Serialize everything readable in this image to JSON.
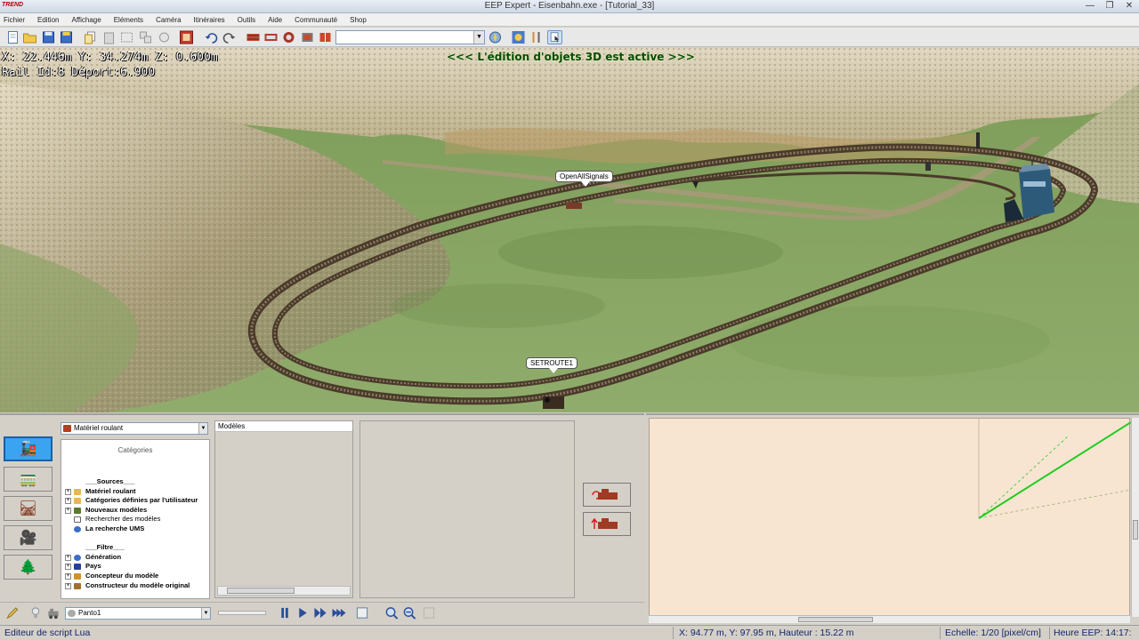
{
  "window": {
    "logo": "TREND",
    "title": "EEP Expert - Eisenbahn.exe - [Tutorial_33]",
    "controls": [
      "minimize",
      "restore",
      "close"
    ]
  },
  "menu": [
    "Fichier",
    "Edition",
    "Affichage",
    "Eléments",
    "Caméra",
    "Itinéraires",
    "Outils",
    "Aide",
    "Communauté",
    "Shop"
  ],
  "toolbar": {
    "search_value": "",
    "icons": [
      "new-file-icon",
      "open-folder-icon",
      "save-icon",
      "save-as-icon",
      "copy-icon",
      "paste-icon",
      "select-icon",
      "group-icon",
      "transfer-icon",
      "signal-editor-icon",
      "undo-icon",
      "redo-icon",
      "track-editor-icon",
      "track-system-icon",
      "tram-track-icon",
      "road-icon",
      "waterway-icon",
      "compass-icon",
      "tools-icon",
      "help-cursor-icon"
    ]
  },
  "viewport": {
    "coord_line": "X: 22.446m  Y: 34.274m  Z: 0.600m",
    "rail_line": "Rail Id:8 Déport:6.900",
    "banner": "<<<  L'édition d'objets 3D est active  >>>",
    "bubbles": {
      "open_signals": "OpenAllSignals",
      "set_route": "SETROUTE1"
    }
  },
  "library": {
    "dropdown": "Matériel roulant",
    "categories_title": "Catégories",
    "models_header": "Modèles",
    "tree": [
      {
        "label": "___Sources___",
        "bold": true,
        "expand": false,
        "icon": ""
      },
      {
        "label": "Matériel roulant",
        "bold": true,
        "expand": true,
        "icon": "folder"
      },
      {
        "label": "Catégories définies par l'utilisateur",
        "bold": true,
        "expand": true,
        "icon": "folder"
      },
      {
        "label": "Nouveaux modèles",
        "bold": true,
        "expand": true,
        "icon": "newmodel"
      },
      {
        "label": "Rechercher des modèles",
        "bold": false,
        "expand": false,
        "icon": "check"
      },
      {
        "label": "La recherche UMS",
        "bold": true,
        "expand": false,
        "icon": "search"
      },
      {
        "label": "",
        "bold": false,
        "expand": false,
        "icon": ""
      },
      {
        "label": "___Filtre___",
        "bold": true,
        "expand": false,
        "icon": ""
      },
      {
        "label": "Génération",
        "bold": true,
        "expand": true,
        "icon": "generation"
      },
      {
        "label": "Pays",
        "bold": true,
        "expand": true,
        "icon": "country"
      },
      {
        "label": "Concepteur du modèle",
        "bold": true,
        "expand": true,
        "icon": "designer"
      },
      {
        "label": "Constructeur du modèle original",
        "bold": true,
        "expand": true,
        "icon": "builder"
      }
    ],
    "side_buttons": [
      "rolling-stock-tab",
      "track-objects-tab",
      "landscape-elements-tab",
      "camera-tab",
      "goods-tab"
    ],
    "action_buttons": [
      "replace-model-button",
      "insert-model-button"
    ]
  },
  "bottom_tools": {
    "object_select": "Panto1"
  },
  "statusbar": {
    "left": "Editeur de script Lua",
    "position": "X: 94.77 m, Y: 97.95 m, Hauteur : 15.22 m",
    "scale": "Echelle: 1/20 [pixel/cm]",
    "time": "Heure EEP: 14:17:"
  },
  "colors": {
    "grass": "#8ca666",
    "rock": "#cfc2a4",
    "map_bg": "#f7e5d2",
    "map_line": "#22cc22",
    "status_text": "#12246b",
    "active_tab": "#3aa4f0"
  }
}
